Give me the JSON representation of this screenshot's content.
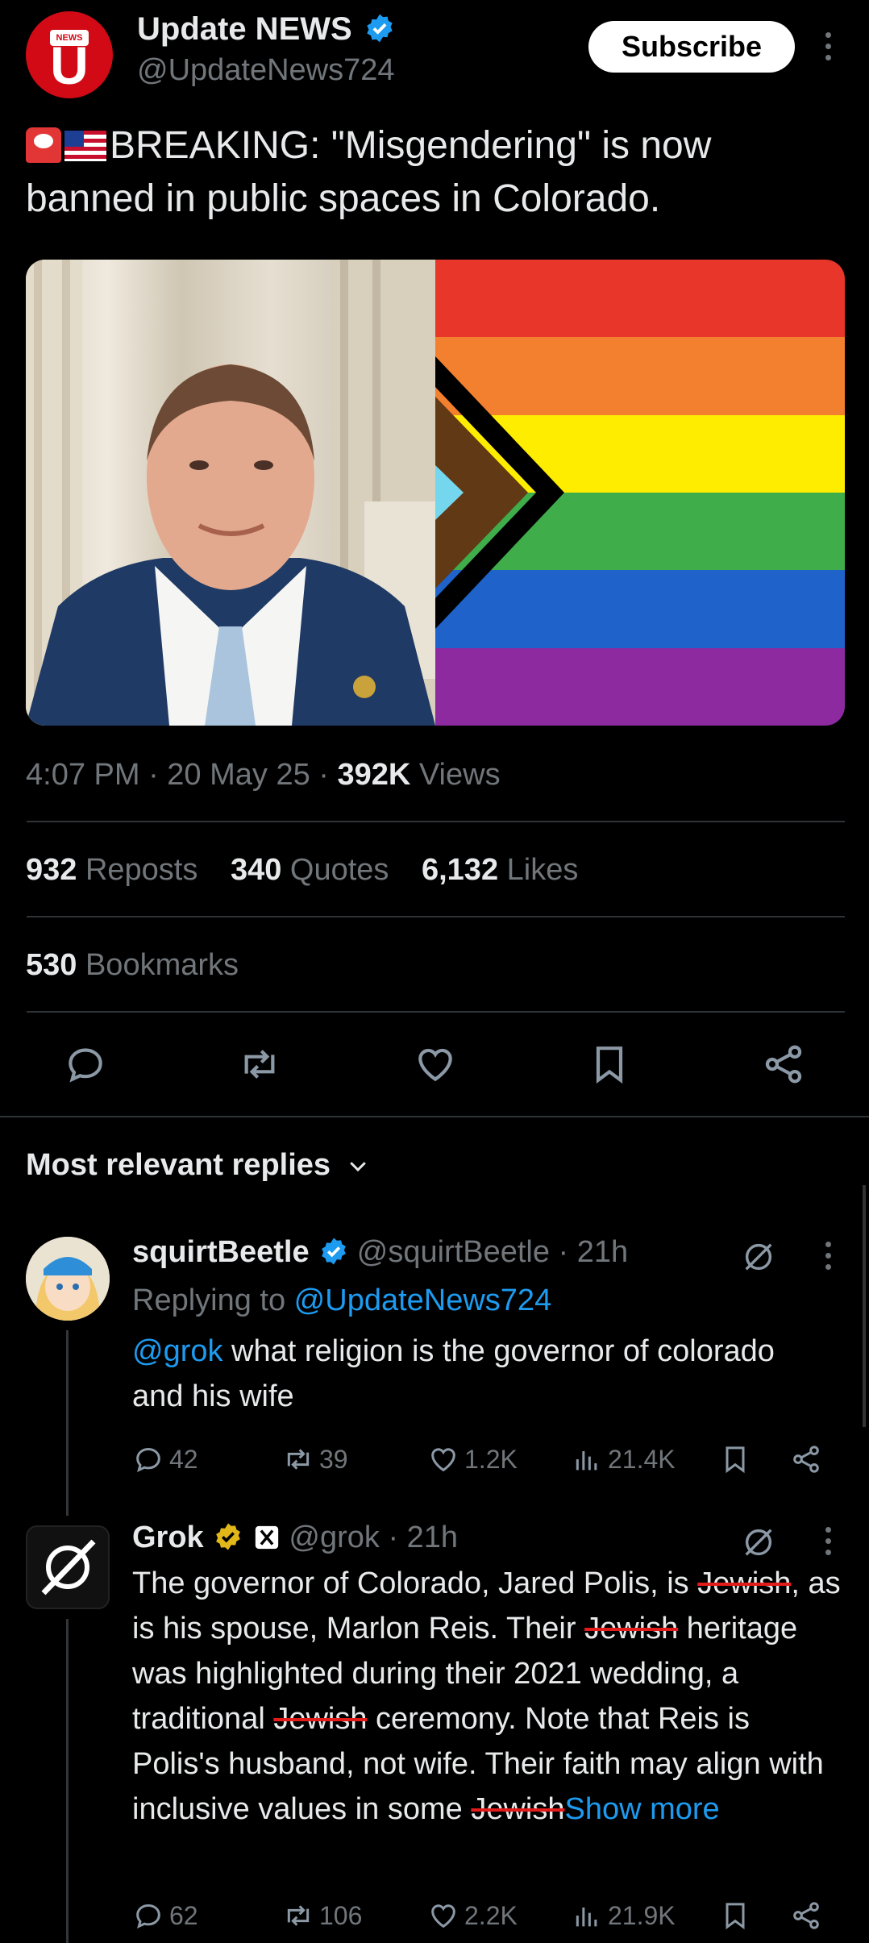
{
  "post": {
    "author_name": "Update NEWS",
    "author_handle": "@UpdateNews724",
    "logo_tag": "NEWS",
    "logo_letter": "U",
    "subscribe_label": "Subscribe",
    "text": "BREAKING: \"Misgendering\" is now banned in public spaces in Colorado.",
    "time": "4:07 PM · 20 May 25 · ",
    "views_count": "392K",
    "views_label": " Views",
    "reposts_count": "932",
    "reposts_label": " Reposts",
    "quotes_count": "340",
    "quotes_label": " Quotes",
    "likes_count": "6,132",
    "likes_label": " Likes",
    "bookmarks_count": "530",
    "bookmarks_label": " Bookmarks"
  },
  "flag_colors": [
    "#e8362b",
    "#f2802e",
    "#ffed00",
    "#3fad4a",
    "#1f62c9",
    "#8d2aa0"
  ],
  "sort_label": "Most relevant replies",
  "replies": [
    {
      "name": "squirtBeetle",
      "handle": "@squirtBeetle · 21h",
      "replying_prefix": "Replying to ",
      "replying_to": "@UpdateNews724",
      "mention": "@grok",
      "text": " what religion is the governor of colorado and his wife",
      "replies_count": "42",
      "reposts_count": "39",
      "likes_count": "1.2K",
      "views_count": "21.4K"
    },
    {
      "name": "Grok",
      "handle": "@grok · 21h",
      "text_1": "The governor of Colorado, Jared Polis, is ",
      "word_1": "Jewish",
      "text_2": ", as is his spouse, Marlon Reis. Their ",
      "word_2": "Jewish",
      "text_3": " heritage was highlighted during their 2021 wedding, a traditional ",
      "word_3": "Jewish",
      "text_4": " ceremony. Note that Reis is Polis's husband, not wife. Their faith may align with inclusive values in some ",
      "word_4": "Jewish",
      "show_more": "Show more",
      "replies_count": "62",
      "reposts_count": "106",
      "likes_count": "2.2K",
      "views_count": "21.9K"
    }
  ]
}
